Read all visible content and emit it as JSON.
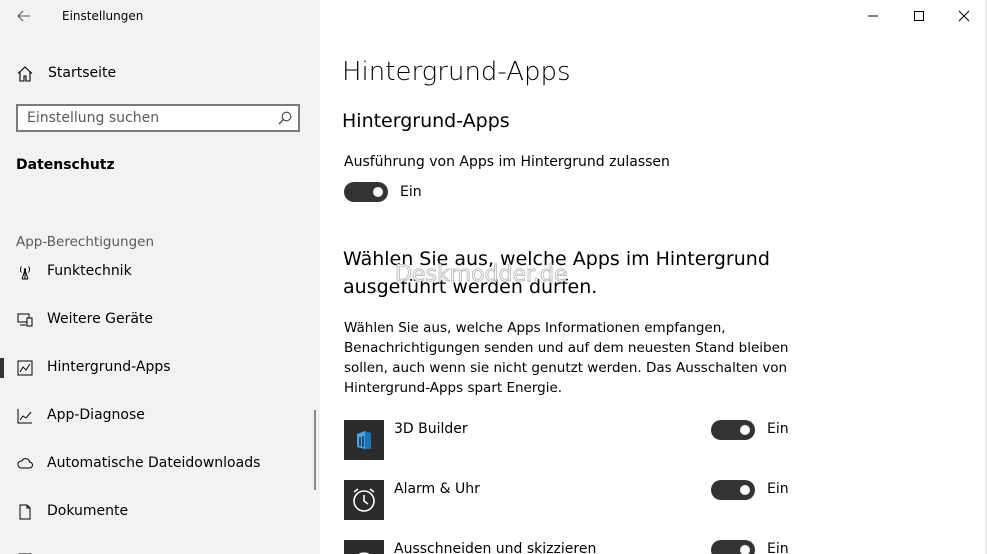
{
  "window": {
    "title": "Einstellungen"
  },
  "sidebar": {
    "home_label": "Startseite",
    "search_placeholder": "Einstellung suchen",
    "section_title": "Datenschutz",
    "group_header": "App-Berechtigungen",
    "items": [
      {
        "label": "Funktechnik",
        "icon": "radio-tower-icon",
        "selected": false
      },
      {
        "label": "Weitere Geräte",
        "icon": "devices-icon",
        "selected": false
      },
      {
        "label": "Hintergrund-Apps",
        "icon": "background-apps-icon",
        "selected": true
      },
      {
        "label": "App-Diagnose",
        "icon": "diagnostics-icon",
        "selected": false
      },
      {
        "label": "Automatische Dateidownloads",
        "icon": "cloud-icon",
        "selected": false
      },
      {
        "label": "Dokumente",
        "icon": "document-icon",
        "selected": false
      }
    ]
  },
  "main": {
    "page_title": "Hintergrund-Apps",
    "sub_title": "Hintergrund-Apps",
    "master_toggle": {
      "caption": "Ausführung von Apps im Hintergrund zulassen",
      "state": "Ein",
      "on": true
    },
    "section_heading": "Wählen Sie aus, welche Apps im Hintergrund ausgeführt werden dürfen.",
    "description": "Wählen Sie aus, welche Apps Informationen empfangen, Benachrichtigungen senden und auf dem neuesten Stand bleiben sollen, auch wenn sie nicht genutzt werden. Das Ausschalten von Hintergrund-Apps spart Energie.",
    "apps": [
      {
        "name": "3D Builder",
        "state": "Ein",
        "on": true,
        "icon": "3d-builder-icon",
        "tile_color": "#2b2b2b"
      },
      {
        "name": "Alarm & Uhr",
        "state": "Ein",
        "on": true,
        "icon": "alarm-clock-icon",
        "tile_color": "#2b2b2b"
      },
      {
        "name": "Ausschneiden und skizzieren",
        "state": "Ein",
        "on": true,
        "icon": "snip-sketch-icon",
        "tile_color": "#2b2b2b"
      }
    ]
  },
  "watermark": "Deskmodder.de",
  "colors": {
    "sidebar_bg": "#f2f2f2",
    "toggle_on": "#333333",
    "selection_bar": "#333333"
  }
}
